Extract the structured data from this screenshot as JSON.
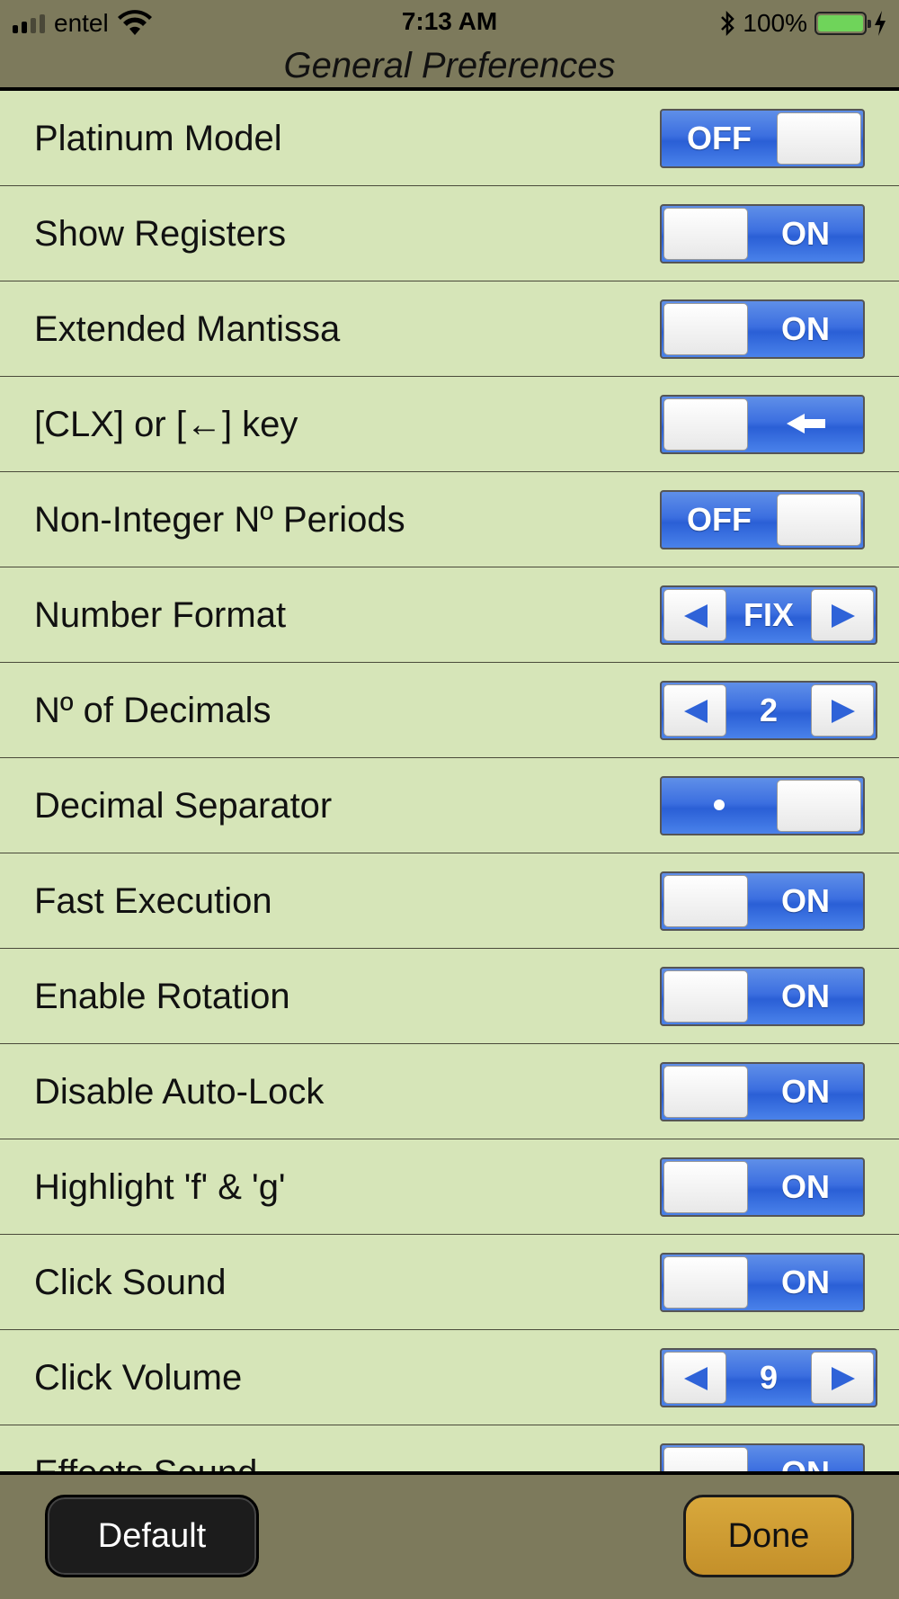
{
  "status_bar": {
    "carrier": "entel",
    "time": "7:13 AM",
    "battery_percent": "100%",
    "icons": [
      "signal-icon",
      "wifi-icon",
      "bluetooth-icon",
      "battery-icon",
      "charging-icon"
    ]
  },
  "header": {
    "title": "General Preferences"
  },
  "colors": {
    "list_background": "#d6e5b8",
    "bar_background": "#7d7a5c",
    "control_blue": "#3c6fe0",
    "done_button": "#c9982e",
    "default_button": "#1c1c1c"
  },
  "settings": [
    {
      "label": "Platinum Model",
      "control": "toggle",
      "state": "off",
      "value": "OFF"
    },
    {
      "label": "Show Registers",
      "control": "toggle",
      "state": "on",
      "value": "ON"
    },
    {
      "label": "Extended Mantissa",
      "control": "toggle",
      "state": "on",
      "value": "ON"
    },
    {
      "label": "[CLX] or [←] key",
      "control": "toggle",
      "state": "on",
      "value": "←"
    },
    {
      "label": "Non-Integer Nº Periods",
      "control": "toggle",
      "state": "off",
      "value": "OFF"
    },
    {
      "label": "Number Format",
      "control": "stepper",
      "value": "FIX"
    },
    {
      "label": "Nº of Decimals",
      "control": "stepper",
      "value": "2"
    },
    {
      "label": "Decimal Separator",
      "control": "toggle",
      "state": "off",
      "value": "•"
    },
    {
      "label": "Fast Execution",
      "control": "toggle",
      "state": "on",
      "value": "ON"
    },
    {
      "label": "Enable Rotation",
      "control": "toggle",
      "state": "on",
      "value": "ON"
    },
    {
      "label": "Disable Auto-Lock",
      "control": "toggle",
      "state": "on",
      "value": "ON"
    },
    {
      "label": "Highlight 'f' & 'g'",
      "control": "toggle",
      "state": "on",
      "value": "ON"
    },
    {
      "label": "Click Sound",
      "control": "toggle",
      "state": "on",
      "value": "ON"
    },
    {
      "label": "Click Volume",
      "control": "stepper",
      "value": "9"
    },
    {
      "label": "Effects Sound",
      "control": "toggle",
      "state": "on",
      "value": "ON"
    }
  ],
  "footer": {
    "default_label": "Default",
    "done_label": "Done"
  }
}
